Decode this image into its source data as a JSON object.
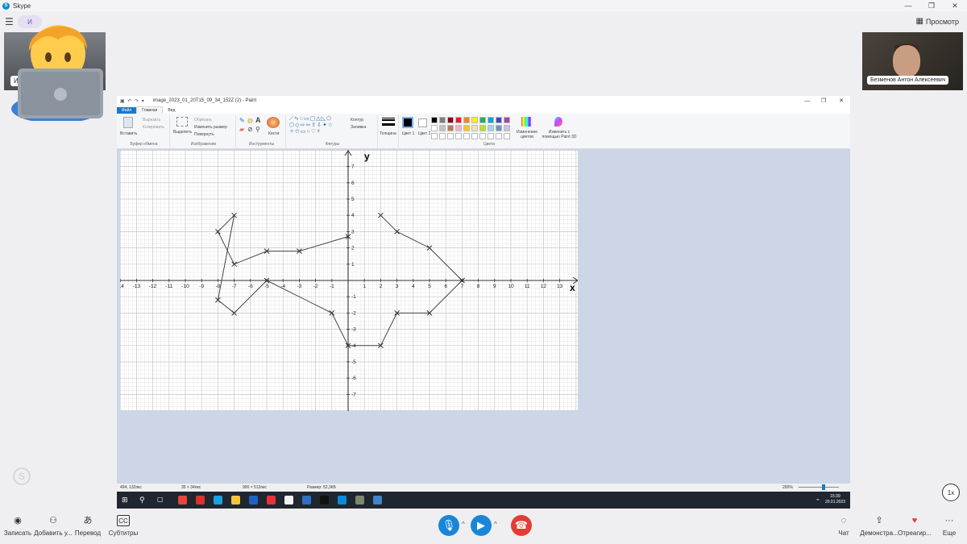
{
  "app": {
    "title": "Skype",
    "logo_letter": "S"
  },
  "topbar": {
    "pill_text": "И",
    "view_label": "Просмотр"
  },
  "participants": {
    "left_tag": "И",
    "right_name": "Безменов Антон Алексеевич"
  },
  "paint": {
    "filename": "image_2023_01_20T15_09_34_152Z (2) - Paint",
    "tabs": [
      "Файл",
      "Главная",
      "Вид"
    ],
    "groups": {
      "clipboard": {
        "label": "Буфер обмена",
        "paste": "Вставить",
        "cut": "Вырезать",
        "copy": "Копировать"
      },
      "image": {
        "label": "Изображение",
        "select": "Выделить",
        "crop": "Обрезать",
        "resize": "Изменить размер",
        "rotate": "Повернуть"
      },
      "tools": {
        "label": "Инструменты",
        "brushes": "Кисти"
      },
      "shapes": {
        "label": "Фигуры",
        "outline": "Контур",
        "fill": "Заливка"
      },
      "size": {
        "label": "Толщина"
      },
      "colors": {
        "label": "Цвета",
        "color1": "Цвет 1",
        "color2": "Цвет 2",
        "edit": "Изменение цветов",
        "paint3d": "Изменить с помощью Paint 3D"
      }
    },
    "palette": [
      "#000000",
      "#7f7f7f",
      "#880015",
      "#ed1c24",
      "#ff7f27",
      "#fff200",
      "#22b14c",
      "#00a2e8",
      "#3f48cc",
      "#a349a4",
      "#ffffff",
      "#c3c3c3",
      "#b97a57",
      "#ffaec9",
      "#ffc90e",
      "#efe4b0",
      "#b5e61d",
      "#99d9ea",
      "#7092be",
      "#c8bfe7"
    ],
    "status": {
      "cursor": "494, 132пкс",
      "selection": "35 × 34пкс",
      "canvas_size": "900 × 512пкс",
      "file_size": "Размер: 52,3КБ",
      "zoom": "200%"
    },
    "clock": {
      "time": "15:39",
      "date": "20.01.2023"
    }
  },
  "chart_data": {
    "type": "line",
    "xlabel": "x",
    "ylabel": "y",
    "xlim": [
      -14,
      13
    ],
    "ylim": [
      -7,
      7
    ],
    "x_ticks": [
      -14,
      -13,
      -12,
      -11,
      -10,
      -9,
      -8,
      -7,
      -6,
      -5,
      -4,
      -3,
      -2,
      -1,
      1,
      2,
      3,
      4,
      5,
      6,
      7,
      8,
      9,
      10,
      11,
      12,
      13
    ],
    "y_ticks": [
      7,
      6,
      5,
      4,
      3,
      2,
      1,
      -1,
      -2,
      -3,
      -4,
      -5,
      -6,
      -7
    ],
    "grid": true,
    "series": [
      {
        "x": [
          0,
          -3,
          -5,
          -7,
          -8,
          -7,
          -8,
          -7,
          -5,
          -1,
          0,
          2,
          3,
          5,
          7
        ],
        "y": [
          2.7,
          1.8,
          1.8,
          1,
          3,
          4,
          -1.2,
          -2,
          0,
          -2,
          -4,
          -4,
          -2,
          -2,
          0
        ]
      },
      {
        "x": [
          2,
          3,
          5,
          7
        ],
        "y": [
          4,
          3,
          2,
          0
        ]
      }
    ]
  },
  "callbar": {
    "record": "Записать",
    "add": "Добавить у...",
    "translate": "Перевод",
    "subtitles": "Субтитры",
    "chat": "Чат",
    "share": "Демонстра...",
    "react": "Отреагир...",
    "more": "Еще",
    "speed": "1x"
  }
}
